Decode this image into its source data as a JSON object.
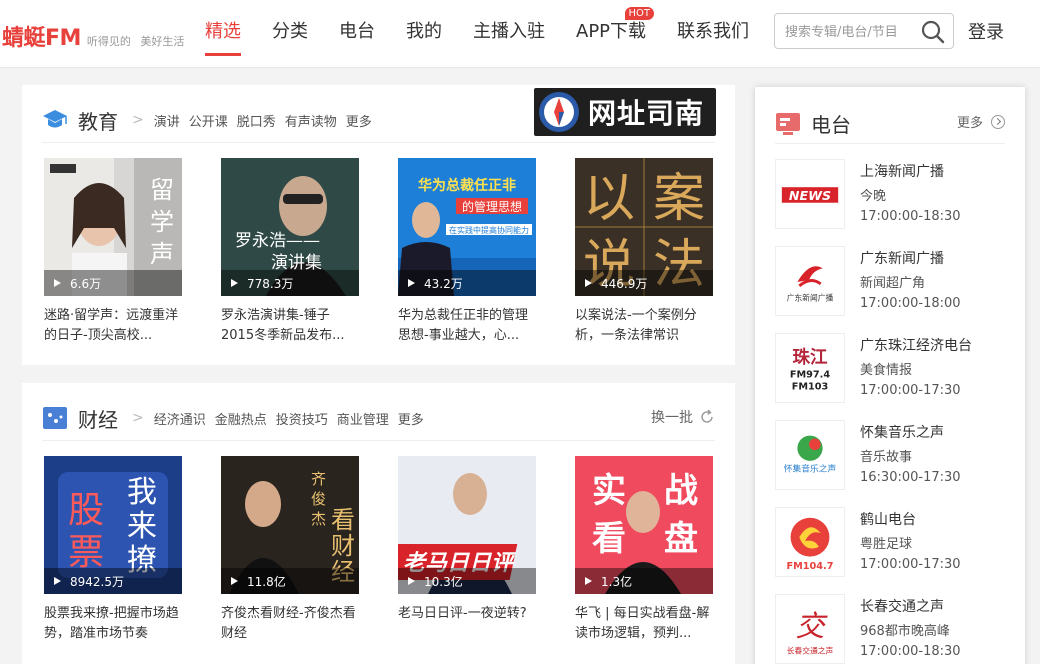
{
  "header": {
    "logo": "蜻蜓FM",
    "slogan": "听得见的 美好生活",
    "nav": [
      {
        "label": "精选",
        "active": true
      },
      {
        "label": "分类"
      },
      {
        "label": "电台"
      },
      {
        "label": "我的"
      },
      {
        "label": "主播入驻"
      },
      {
        "label": "APP下载",
        "badge": "HOT"
      },
      {
        "label": "联系我们"
      }
    ],
    "search_placeholder": "搜索专辑/电台/节目",
    "login": "登录"
  },
  "education": {
    "title": "教育",
    "sub_links": [
      "演讲",
      "公开课",
      "脱口秀",
      "有声读物",
      "更多"
    ],
    "ad_text": "网址司南",
    "items": [
      {
        "plays": "6.6万",
        "title": "迷路·留学声：远渡重洋的日子-顶尖高校...",
        "cover_text": "留学声"
      },
      {
        "plays": "778.3万",
        "title": "罗永浩演讲集-锤子2015冬季新品发布...",
        "cover_text": "罗永浩 演讲集"
      },
      {
        "plays": "43.2万",
        "title": "华为总裁任正非的管理思想-事业越大，心...",
        "cover_text": "华为总裁任正非 的管理思想"
      },
      {
        "plays": "446.9万",
        "title": "以案说法-一个案例分析，一条法律常识",
        "cover_text": "以案说法"
      }
    ]
  },
  "finance": {
    "title": "财经",
    "sub_links": [
      "经济通识",
      "金融热点",
      "投资技巧",
      "商业管理",
      "更多"
    ],
    "refresh": "换一批",
    "items": [
      {
        "plays": "8942.5万",
        "title": "股票我来撩-把握市场趋势，踏准市场节奏",
        "cover_text": "股票 我来撩"
      },
      {
        "plays": "11.8亿",
        "title": "齐俊杰看财经-齐俊杰看财经",
        "cover_text": "齐俊杰 看财经"
      },
      {
        "plays": "10.3亿",
        "title": "老马日日评-一夜逆转?",
        "cover_text": "老马日日评"
      },
      {
        "plays": "1.3亿",
        "title": "华飞 | 每日实战看盘-解读市场逻辑，预判...",
        "cover_text": "实战 看盘"
      }
    ]
  },
  "radio": {
    "title": "电台",
    "more": "更多",
    "stations": [
      {
        "name": "上海新闻广播",
        "program": "今晚",
        "time": "17:00:00-18:30",
        "logo_text": "NEWS"
      },
      {
        "name": "广东新闻广播",
        "program": "新闻超广角",
        "time": "17:00:00-18:00",
        "logo_text": "广东新闻广播"
      },
      {
        "name": "广东珠江经济电台",
        "program": "美食情报",
        "time": "17:00:00-17:30",
        "logo_text": "珠江 FM97.4 FM103"
      },
      {
        "name": "怀集音乐之声",
        "program": "音乐故事",
        "time": "16:30:00-17:30",
        "logo_text": "怀集音乐之声"
      },
      {
        "name": "鹤山电台",
        "program": "粤胜足球",
        "time": "17:00:00-17:30",
        "logo_text": "FM104.7"
      },
      {
        "name": "长春交通之声",
        "program": "968都市晚高峰",
        "time": "17:00:00-18:30",
        "logo_text": "长春交通之声"
      }
    ]
  },
  "colors": {
    "accent": "#e8413c"
  }
}
